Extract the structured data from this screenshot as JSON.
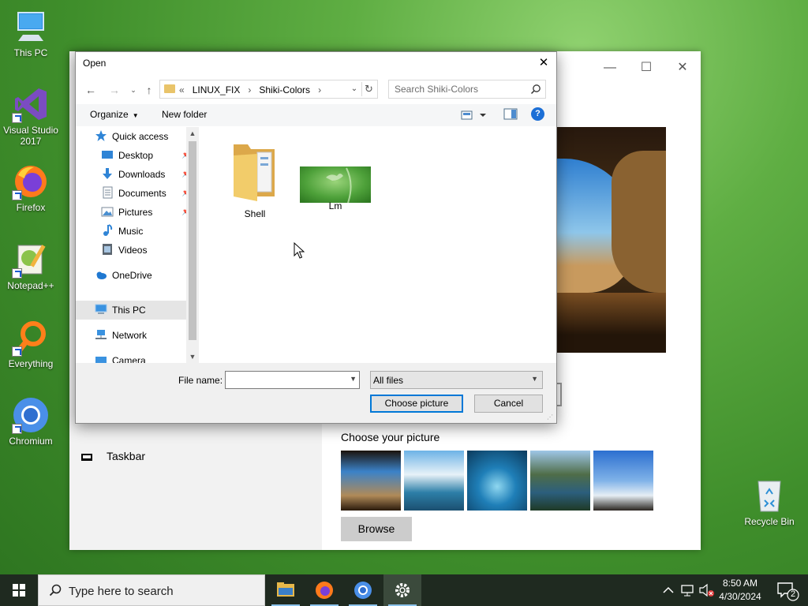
{
  "desktop": {
    "icons": [
      {
        "label": "This PC"
      },
      {
        "label": "Visual Studio 2017"
      },
      {
        "label": "Firefox"
      },
      {
        "label": "Notepad++"
      },
      {
        "label": "Everything"
      },
      {
        "label": "Chromium"
      }
    ],
    "recycle_bin": "Recycle Bin"
  },
  "settings_window": {
    "taskbar_item": "Taskbar",
    "choose_title": "Choose your picture",
    "browse_label": "Browse"
  },
  "dialog": {
    "title": "Open",
    "address": {
      "chevron": "«",
      "crumbs": [
        "LINUX_FIX",
        "Shiki-Colors"
      ],
      "separator": "›"
    },
    "search_placeholder": "Search Shiki-Colors",
    "toolbar": {
      "organize": "Organize",
      "new_folder": "New folder",
      "help": "?"
    },
    "nav_items": [
      {
        "label": "Quick access",
        "icon": "star-icon"
      },
      {
        "label": "Desktop",
        "icon": "desktop-icon",
        "pinned": true
      },
      {
        "label": "Downloads",
        "icon": "download-icon",
        "pinned": true
      },
      {
        "label": "Documents",
        "icon": "document-icon",
        "pinned": true
      },
      {
        "label": "Pictures",
        "icon": "pictures-icon",
        "pinned": true
      },
      {
        "label": "Music",
        "icon": "music-icon"
      },
      {
        "label": "Videos",
        "icon": "video-icon"
      },
      {
        "label": "OneDrive",
        "icon": "cloud-icon"
      },
      {
        "label": "This PC",
        "icon": "computer-icon",
        "selected": true
      },
      {
        "label": "Network",
        "icon": "network-icon"
      },
      {
        "label": "Camera",
        "icon": "camera-icon"
      }
    ],
    "files": [
      {
        "name": "Shell",
        "type": "folder"
      },
      {
        "name": "Lm",
        "type": "image"
      }
    ],
    "file_name_label": "File name:",
    "file_name_value": "",
    "file_type": "All files",
    "buttons": {
      "choose": "Choose picture",
      "cancel": "Cancel"
    }
  },
  "taskbar": {
    "search_placeholder": "Type here to search",
    "time": "8:50 AM",
    "date": "4/30/2024",
    "notification_count": "2"
  },
  "colors": {
    "accent": "#0078d7",
    "desktop_green": "#4b9c35",
    "taskbar": "#1f2a20"
  }
}
